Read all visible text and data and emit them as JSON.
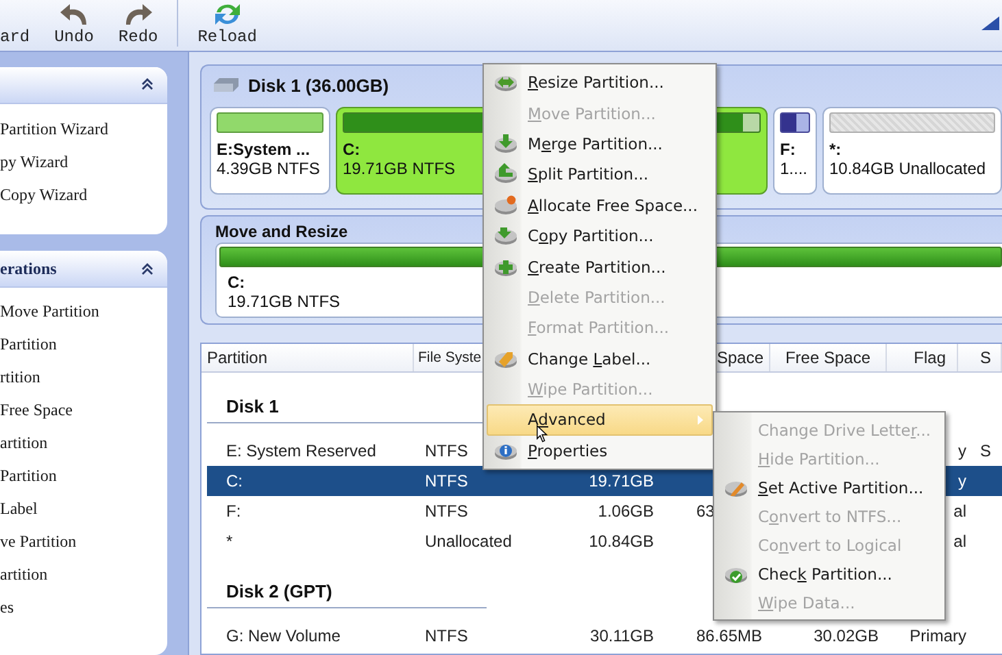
{
  "toolbar": {
    "buttons": [
      {
        "kind": "wizard",
        "label": "ard"
      },
      {
        "kind": "undo",
        "label": "Undo"
      },
      {
        "kind": "redo",
        "label": "Redo"
      },
      {
        "kind": "reload",
        "label": "Reload"
      }
    ]
  },
  "sidebar": {
    "panels": [
      {
        "items": [
          "Partition Wizard",
          "py Wizard",
          "Copy Wizard"
        ]
      },
      {
        "title": "erations",
        "items": [
          "Move Partition",
          "Partition",
          "rtition",
          "Free Space",
          "artition",
          "Partition",
          "Label",
          "ve Partition",
          "artition",
          "es"
        ]
      }
    ]
  },
  "disk_map": {
    "title": "Disk 1 (36.00GB)",
    "partitions": [
      {
        "kind": "system",
        "name": "E:System ...",
        "detail": "4.39GB NTFS",
        "selected": false
      },
      {
        "kind": "primary",
        "name": "C:",
        "detail": "19.71GB NTFS",
        "selected": true
      },
      {
        "kind": "logical",
        "name": "F:",
        "detail": "1....",
        "selected": false
      },
      {
        "kind": "unallocated",
        "name": "*:",
        "detail": "10.84GB Unallocated",
        "selected": false
      }
    ]
  },
  "move_resize": {
    "title": "Move and Resize",
    "name": "C:",
    "detail": "19.71GB NTFS"
  },
  "table": {
    "columns": {
      "partition": "Partition",
      "file_system": "File Syste",
      "used": "Space",
      "unused": "Free Space",
      "flag": "Flag",
      "status": "S"
    },
    "groups": [
      {
        "title": "Disk 1",
        "rows": [
          {
            "selected": false,
            "cells": {
              "partition": "E:  System Reserved",
              "file_system": "NTFS",
              "flag": "y",
              "status": "S"
            }
          },
          {
            "selected": true,
            "cells": {
              "partition": "C:",
              "file_system": "NTFS",
              "capacity": "19.71GB",
              "flag": "y"
            }
          },
          {
            "selected": false,
            "cells": {
              "partition": "F:",
              "file_system": "NTFS",
              "capacity": "1.06GB",
              "used": "63",
              "flag": "al"
            }
          },
          {
            "selected": false,
            "cells": {
              "partition": "*",
              "file_system": "Unallocated",
              "capacity": "10.84GB",
              "flag": "al"
            }
          }
        ]
      },
      {
        "title": "Disk 2 (GPT)",
        "rows": [
          {
            "selected": false,
            "cells": {
              "partition": "G:  New Volume",
              "file_system": "NTFS",
              "capacity": "30.11GB",
              "used": "86.65MB",
              "unused": "30.02GB",
              "flag": "Primary"
            }
          }
        ]
      }
    ]
  },
  "context_menu": {
    "items": [
      {
        "key": "R",
        "post": "esize Partition...",
        "disabled": false,
        "selected": false
      },
      {
        "key": "M",
        "post": "ove Partition...",
        "disabled": true,
        "selected": false
      },
      {
        "pre": "M",
        "key": "e",
        "post": "rge Partition...",
        "disabled": false,
        "selected": false
      },
      {
        "key": "S",
        "post": "plit Partition...",
        "disabled": false,
        "selected": false
      },
      {
        "key": "A",
        "post": "llocate Free Space...",
        "disabled": false,
        "selected": false
      },
      {
        "pre": "C",
        "key": "o",
        "post": "py Partition...",
        "disabled": false,
        "selected": false
      },
      {
        "key": "C",
        "post": "reate Partition...",
        "disabled": false,
        "selected": false
      },
      {
        "key": "D",
        "post": "elete Partition...",
        "disabled": true,
        "selected": false
      },
      {
        "key": "F",
        "post": "ormat Partition...",
        "disabled": true,
        "selected": false
      },
      {
        "pre": "Change ",
        "key": "L",
        "post": "abel...",
        "disabled": false,
        "selected": false
      },
      {
        "key": "W",
        "post": "ipe Partition...",
        "disabled": true,
        "selected": false
      },
      {
        "pre": "A",
        "key": "d",
        "post": "vanced",
        "disabled": false,
        "selected": true,
        "submenu": true
      },
      {
        "key": "P",
        "post": "roperties",
        "disabled": false,
        "selected": false
      }
    ]
  },
  "submenu": {
    "items": [
      {
        "pre": "Change Drive Lette",
        "key": "r",
        "post": "...",
        "disabled": true,
        "selected": false
      },
      {
        "key": "H",
        "post": "ide Partition...",
        "disabled": true,
        "selected": false
      },
      {
        "key": "S",
        "post": "et Active Partition...",
        "disabled": false,
        "selected": false
      },
      {
        "pre": "C",
        "key": "o",
        "post": "nvert to NTFS...",
        "disabled": true,
        "selected": false
      },
      {
        "pre": "Co",
        "key": "n",
        "post": "vert to Logical",
        "disabled": true,
        "selected": false
      },
      {
        "pre": "Chec",
        "key": "k",
        "post": " Partition...",
        "disabled": false,
        "selected": false
      },
      {
        "key": "W",
        "post": "ipe Data...",
        "disabled": true,
        "selected": false
      }
    ]
  }
}
